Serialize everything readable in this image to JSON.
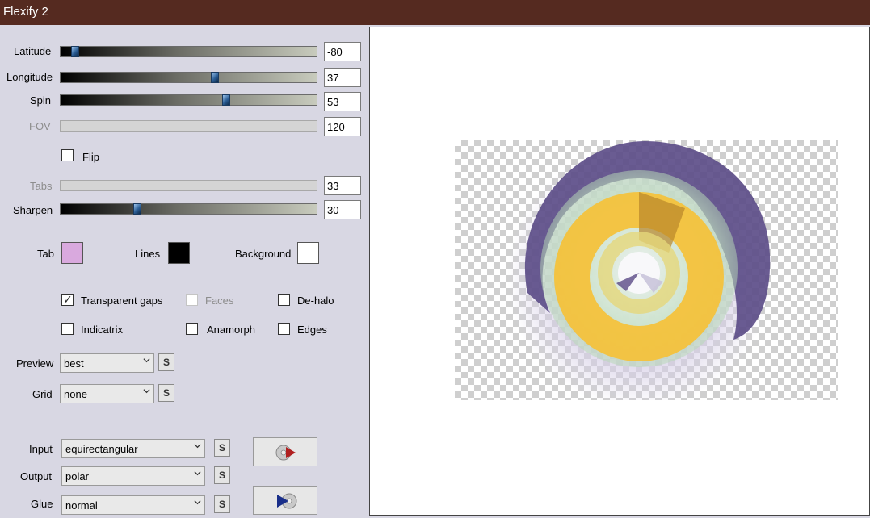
{
  "window": {
    "title": "Flexify 2"
  },
  "params": {
    "latitude": {
      "label": "Latitude",
      "value": "-80",
      "min": -90,
      "max": 90,
      "num": -80
    },
    "longitude": {
      "label": "Longitude",
      "value": "37",
      "min": -180,
      "max": 180,
      "num": 37
    },
    "spin": {
      "label": "Spin",
      "value": "53",
      "min": -180,
      "max": 180,
      "num": 53
    },
    "fov": {
      "label": "FOV",
      "value": "120"
    },
    "flip": {
      "label": "Flip",
      "checked": false
    },
    "tabs": {
      "label": "Tabs",
      "value": "33"
    },
    "sharpen": {
      "label": "Sharpen",
      "value": "30",
      "min": 0,
      "max": 100,
      "num": 30
    }
  },
  "colors": {
    "tab": {
      "label": "Tab",
      "color": "#d9a9de"
    },
    "lines": {
      "label": "Lines",
      "color": "#000000"
    },
    "background": {
      "label": "Background",
      "color": "#ffffff"
    }
  },
  "options": {
    "transparent_gaps": {
      "label": "Transparent gaps",
      "checked": true
    },
    "faces": {
      "label": "Faces",
      "checked": false,
      "disabled": true
    },
    "dehalo": {
      "label": "De-halo",
      "checked": false
    },
    "indicatrix": {
      "label": "Indicatrix",
      "checked": false
    },
    "anamorph": {
      "label": "Anamorph",
      "checked": false
    },
    "edges": {
      "label": "Edges",
      "checked": false
    }
  },
  "selects": {
    "preview": {
      "label": "Preview",
      "value": "best"
    },
    "grid": {
      "label": "Grid",
      "value": "none"
    },
    "input": {
      "label": "Input",
      "value": "equirectangular"
    },
    "output": {
      "label": "Output",
      "value": "polar"
    },
    "glue": {
      "label": "Glue",
      "value": "normal"
    }
  },
  "icons": {
    "swap": "S",
    "swap_icon": "swap-icon",
    "play_icon": "play-disc-icon",
    "forward_icon": "forward-disc-icon"
  },
  "theme": {
    "titlebar": "#552a20",
    "panel": "#d8d7e3",
    "ring_yellow": "#f4c23c",
    "ring_purple": "#5a4a86",
    "ring_green": "#bfe0c0"
  }
}
